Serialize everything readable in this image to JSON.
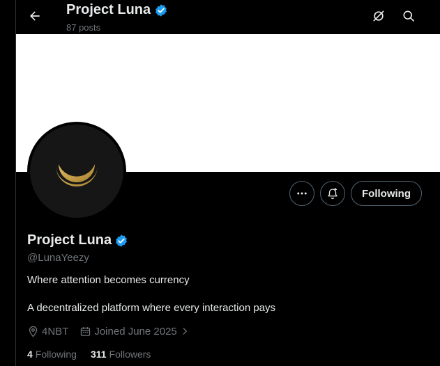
{
  "header": {
    "title": "Project Luna",
    "posts_count": "87 posts",
    "back_icon": "arrow-left-icon",
    "grok_icon": "grok-icon",
    "search_icon": "search-icon"
  },
  "profile": {
    "display_name": "Project Luna",
    "handle": "@LunaYeezy",
    "bio_line_1": "Where attention becomes currency",
    "bio_line_2": "A decentralized platform where every interaction pays",
    "location": "4NBT",
    "joined": "Joined June 2025",
    "verified": true
  },
  "actions": {
    "more_icon": "more-horizontal-icon",
    "notify_icon": "bell-plus-icon",
    "follow_label": "Following"
  },
  "stats": {
    "following_count": "4",
    "following_label": "Following",
    "followers_count": "311",
    "followers_label": "Followers"
  },
  "colors": {
    "background": "#000000",
    "verified_badge": "#1d9bf0",
    "secondary_text": "#71767b",
    "moon_gold": "#c9a24a",
    "banner": "#ffffff"
  }
}
